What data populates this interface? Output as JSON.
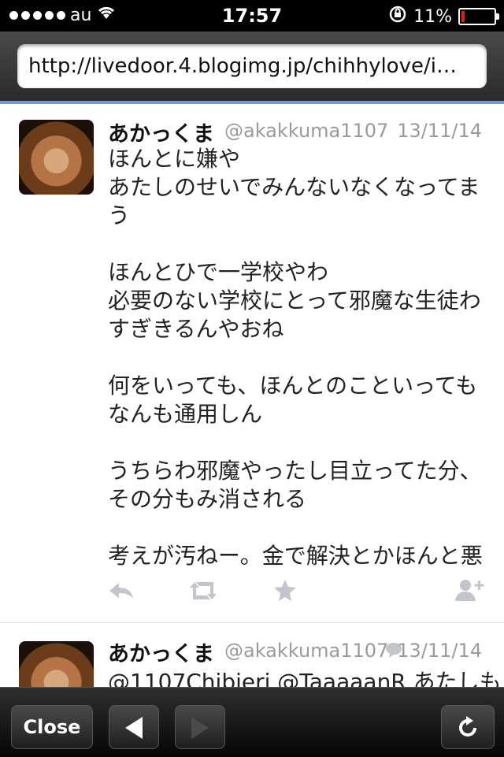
{
  "status_bar": {
    "carrier": "au",
    "time": "17:57",
    "battery_percent": "11%",
    "battery_level": 0.11
  },
  "url_bar": {
    "url": "http://livedoor.4.blogimg.jp/chihhylove/img…"
  },
  "tweets": [
    {
      "name": "あかっくま",
      "handle": "@akakkuma1107",
      "date": "13/11/14",
      "paragraphs": [
        "ほんとに嫌や\nあたしのせいでみんないなくなってまう",
        "ほんとひで一学校やわ\n必要のない学校にとって邪魔な生徒わすぎきるんやおね",
        "何をいっても、ほんとのこといってもなんも通用しん",
        "うちらわ邪魔やったし目立ってた分、その分もみ消される",
        "考えが汚ねー。金で解決とかほんと悪"
      ]
    },
    {
      "name": "あかっくま",
      "handle": "@akakkuma1107",
      "date": "13/11/14",
      "text": "@1107Chibieri @TaaaaanR あたしも"
    }
  ],
  "toolbar": {
    "close_label": "Close"
  },
  "icons": {
    "reply": "reply-icon",
    "retweet": "retweet-icon",
    "favorite": "star-icon",
    "follow": "add-user-icon",
    "reload": "reload-icon"
  }
}
